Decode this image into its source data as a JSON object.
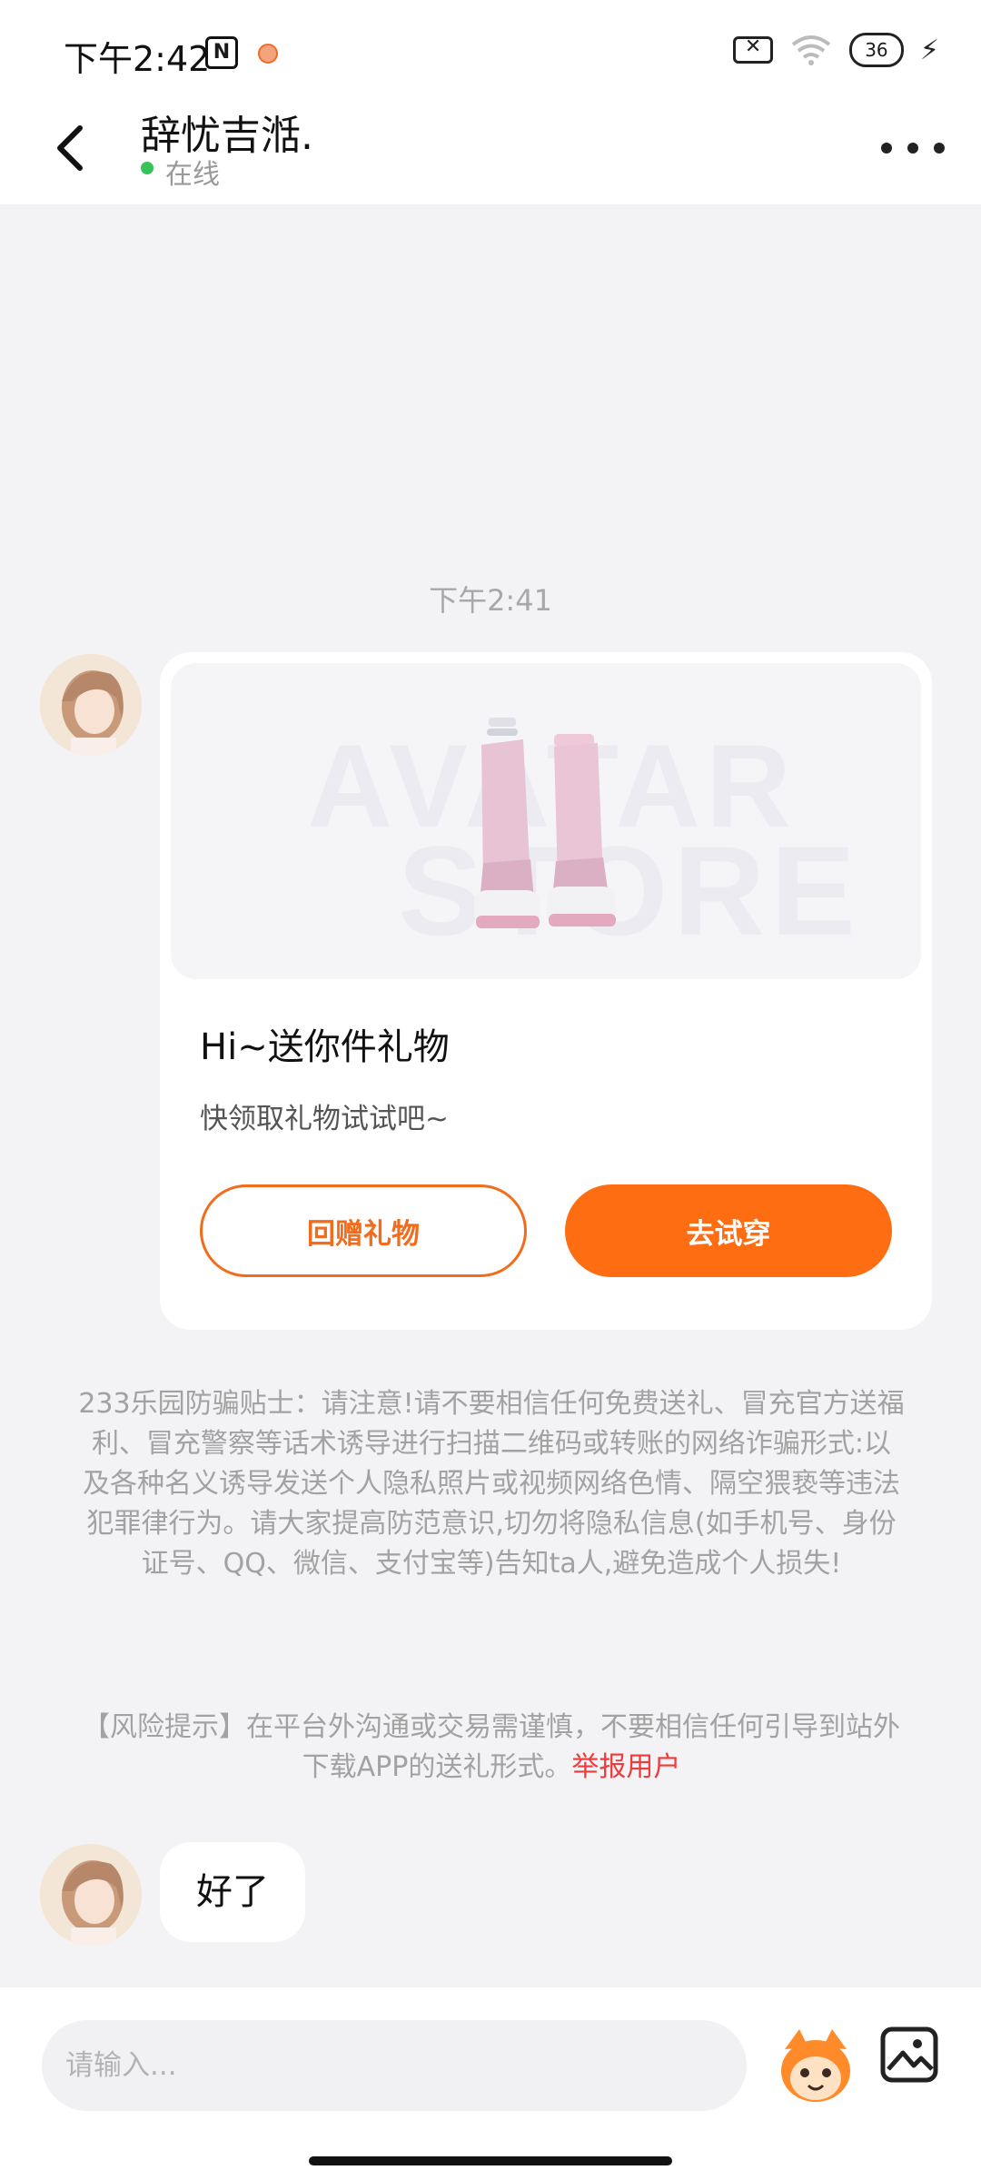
{
  "status_bar": {
    "time": "下午2:42",
    "nfc_icon": "nfc-icon",
    "battery_level": "36"
  },
  "header": {
    "name": "辞忧吉湉.",
    "status": "在线"
  },
  "chat": {
    "timestamp": "下午2:41",
    "gift_card": {
      "title": "Hi~送你件礼物",
      "description": "快领取礼物试试吧~",
      "return_gift_label": "回赠礼物",
      "try_on_label": "去试穿",
      "watermark_line1": "AVATAR",
      "watermark_line2": "STORE"
    },
    "anti_fraud_notice": "233乐园防骗贴士：请注意!请不要相信任何免费送礼、冒充官方送福利、冒充警察等话术诱导进行扫描二维码或转账的网络诈骗形式:以及各种名义诱导发送个人隐私照片或视频网络色情、隔空猥亵等违法犯罪律行为。请大家提高防范意识,切勿将隐私信息(如手机号、身份证号、QQ、微信、支付宝等)告知ta人,避免造成个人损失!",
    "risk_notice": "【风险提示】在平台外沟通或交易需谨慎，不要相信任何引导到站外下载APP的送礼形式。",
    "report_link": "举报用户",
    "message": "好了"
  },
  "input": {
    "placeholder": "请输入..."
  },
  "colors": {
    "accent": "#ff6d12",
    "online": "#35c35a",
    "report": "#ef3b3b"
  }
}
